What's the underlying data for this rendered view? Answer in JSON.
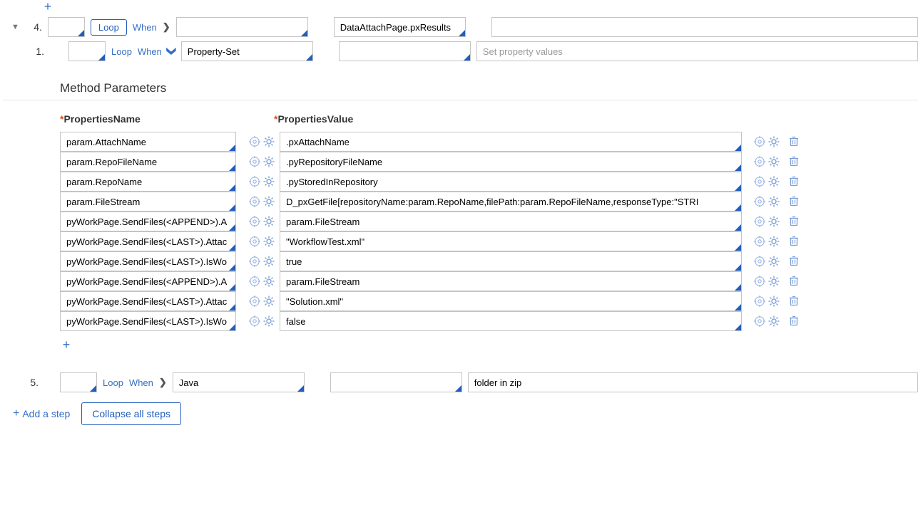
{
  "step4": {
    "number": "4.",
    "loop_btn": "Loop",
    "when_link": "When",
    "step_page": "DataAttachPage.pxResults",
    "description": "",
    "sub": {
      "number": "1.",
      "loop_link": "Loop",
      "when_link": "When",
      "method": "Property-Set",
      "step_page": "",
      "description_placeholder": "Set property values"
    }
  },
  "method_params": {
    "title": "Method Parameters",
    "col_name": "PropertiesName",
    "col_value": "PropertiesValue",
    "rows": [
      {
        "name": "param.AttachName",
        "value": ".pxAttachName"
      },
      {
        "name": "param.RepoFileName",
        "value": ".pyRepositoryFileName"
      },
      {
        "name": "param.RepoName",
        "value": ".pyStoredInRepository"
      },
      {
        "name": "param.FileStream",
        "value": "D_pxGetFile[repositoryName:param.RepoName,filePath:param.RepoFileName,responseType:\"STRI"
      },
      {
        "name": "pyWorkPage.SendFiles(<APPEND>).A",
        "value": "param.FileStream"
      },
      {
        "name": "pyWorkPage.SendFiles(<LAST>).Attac",
        "value": "\"WorkflowTest.xml\""
      },
      {
        "name": "pyWorkPage.SendFiles(<LAST>).IsWo",
        "value": "true",
        "highlight": true
      },
      {
        "name": "pyWorkPage.SendFiles(<APPEND>).A",
        "value": "param.FileStream"
      },
      {
        "name": "pyWorkPage.SendFiles(<LAST>).Attac",
        "value": "\"Solution.xml\""
      },
      {
        "name": "pyWorkPage.SendFiles(<LAST>).IsWo",
        "value": "false"
      }
    ]
  },
  "step5": {
    "number": "5.",
    "loop_link": "Loop",
    "when_link": "When",
    "method": "Java",
    "step_page": "",
    "description": "folder in zip"
  },
  "footer": {
    "add_step": "Add a step",
    "collapse": "Collapse all steps"
  }
}
